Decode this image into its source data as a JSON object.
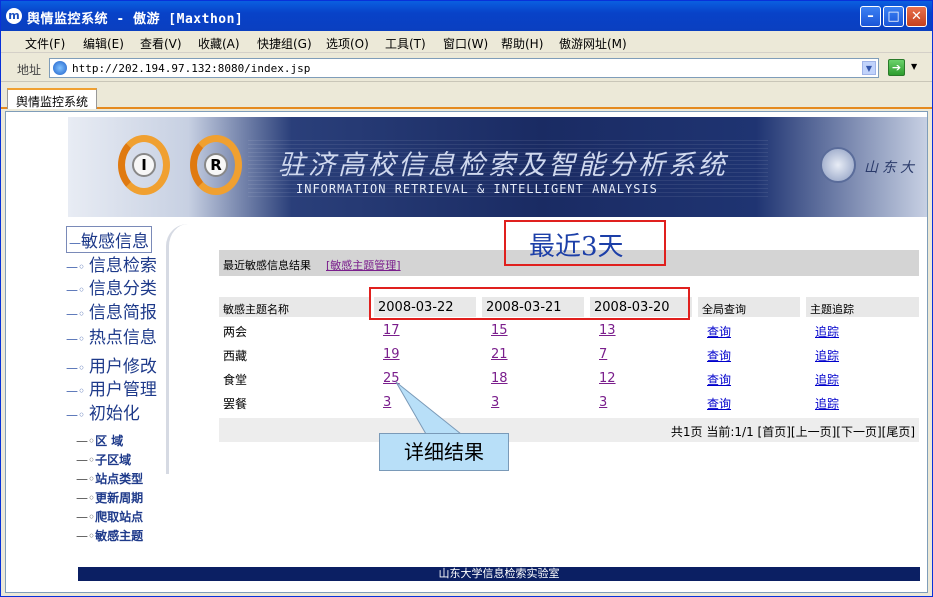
{
  "window": {
    "title": "舆情监控系统 - 傲游 [Maxthon]",
    "app_icon": "m"
  },
  "menu": [
    "文件(F)",
    "编辑(E)",
    "查看(V)",
    "收藏(A)",
    "快捷组(G)",
    "选项(O)",
    "工具(T)",
    "窗口(W)",
    "帮助(H)",
    "傲游网址(M)"
  ],
  "address": {
    "label": "地址",
    "url": "http://202.194.97.132:8080/index.jsp"
  },
  "tab": {
    "label": "舆情监控系统"
  },
  "banner": {
    "logo_left": "I",
    "logo_right": "R",
    "cn_title": "驻济高校信息检索及智能分析系统",
    "en_title": "INFORMATION RETRIEVAL & INTELLIGENT ANALYSIS",
    "emblem_text": "山东大"
  },
  "nav": {
    "main": [
      "敏感信息",
      "信息检索",
      "信息分类",
      "信息简报",
      "热点信息",
      "用户修改",
      "用户管理",
      "初始化"
    ],
    "sub": [
      "区 域",
      "子区域",
      "站点类型",
      "更新周期",
      "爬取站点",
      "敏感主题"
    ]
  },
  "annotations": {
    "recent": "最近3天",
    "detail": "详细结果"
  },
  "results": {
    "title": "最近敏感信息结果",
    "manage_link": "[敏感主题管理]",
    "headers": {
      "topic": "敏感主题名称",
      "dates": [
        "2008-03-22",
        "2008-03-21",
        "2008-03-20"
      ],
      "global_query": "全局查询",
      "topic_track": "主题追踪"
    },
    "rows": [
      {
        "topic": "两会",
        "counts": [
          "17",
          "15",
          "13"
        ],
        "query": "查询",
        "track": "追踪"
      },
      {
        "topic": "西藏",
        "counts": [
          "19",
          "21",
          "7"
        ],
        "query": "查询",
        "track": "追踪"
      },
      {
        "topic": "食堂",
        "counts": [
          "25",
          "18",
          "12"
        ],
        "query": "查询",
        "track": "追踪"
      },
      {
        "topic": "罢餐",
        "counts": [
          "3",
          "3",
          "3"
        ],
        "query": "查询",
        "track": "追踪"
      }
    ],
    "pager": "共1页 当前:1/1 [首页][上一页][下一页][尾页]"
  },
  "footer": "山东大学信息检索实验室"
}
